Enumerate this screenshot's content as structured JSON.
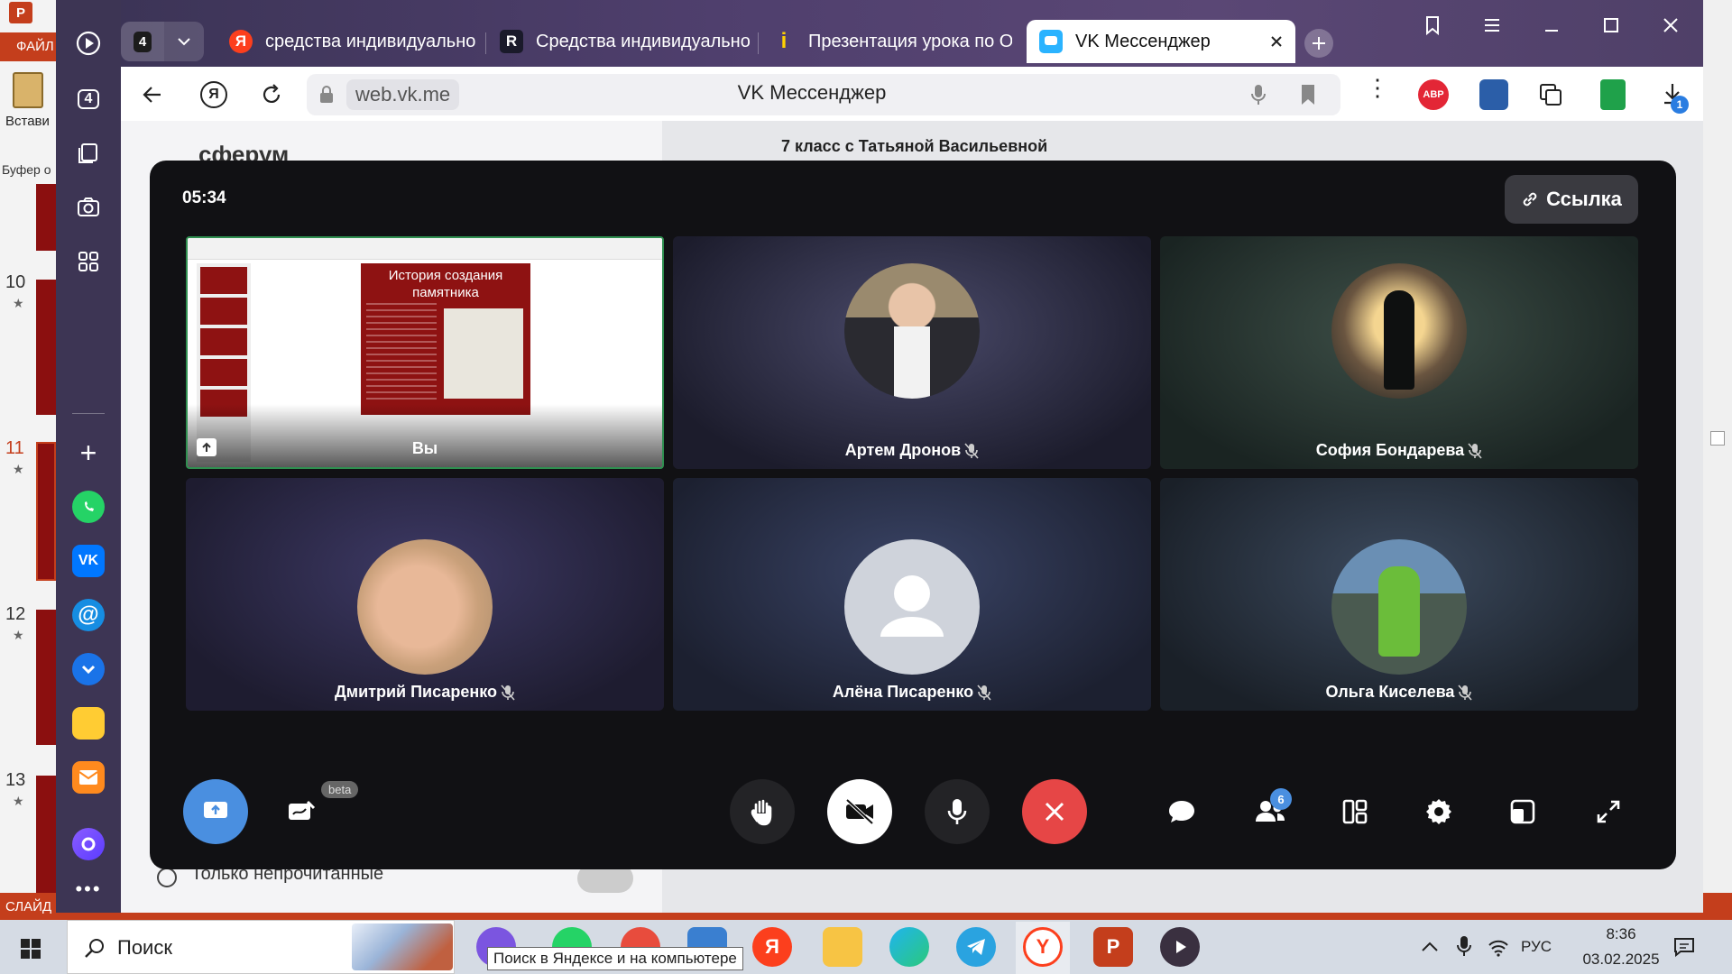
{
  "colors": {
    "accent": "#4a8fe0",
    "end_call": "#e64646",
    "ppt": "#c43e1c"
  },
  "powerpoint": {
    "logo": "P",
    "tab_file": "ФАЙЛ",
    "paste_label": "Встави",
    "clipboard_label": "Буфер о",
    "slide_numbers": [
      "10",
      "11",
      "12",
      "13"
    ],
    "status_label": "СЛАЙД"
  },
  "browser": {
    "tab_count": "4",
    "tabs": [
      {
        "label": "средства индивидуально",
        "icon": "yandex-icon",
        "icon_char": "Я"
      },
      {
        "label": "Средства индивидуально",
        "icon": "r-icon",
        "icon_char": "R"
      },
      {
        "label": "Презентация урока по ОБ",
        "icon": "info-icon",
        "icon_char": "i"
      },
      {
        "label": "VK Мессенджер",
        "icon": "vk-messenger-icon",
        "icon_char": ""
      }
    ],
    "url": "web.vk.me",
    "page_title": "VK Мессенджер",
    "rail_badge": "4",
    "download_badge": "1",
    "abp_label": "ABP"
  },
  "vk_page": {
    "brand": "сферум",
    "chat_title": "7 класс с Татьяной Васильевной",
    "unread_filter": "Только непрочитанные"
  },
  "call": {
    "timer": "05:34",
    "link_button": "Ссылка",
    "screen_share": {
      "you_label": "Вы",
      "slide_title": "История создания памятника"
    },
    "participants": [
      {
        "name": "Артем Дронов",
        "muted": true
      },
      {
        "name": "София Бондарева",
        "muted": true
      },
      {
        "name": "Дмитрий Писаренко",
        "muted": true
      },
      {
        "name": "Алёна Писаренко",
        "muted": true
      },
      {
        "name": "Ольга Киселева",
        "muted": true
      }
    ],
    "controls": {
      "beta_label": "beta",
      "participants_count": "6"
    }
  },
  "taskbar": {
    "search_placeholder": "Поиск",
    "tooltip": "Поиск в Яндексе и на компьютере",
    "language": "РУС",
    "time": "8:36",
    "date": "03.02.2025"
  }
}
